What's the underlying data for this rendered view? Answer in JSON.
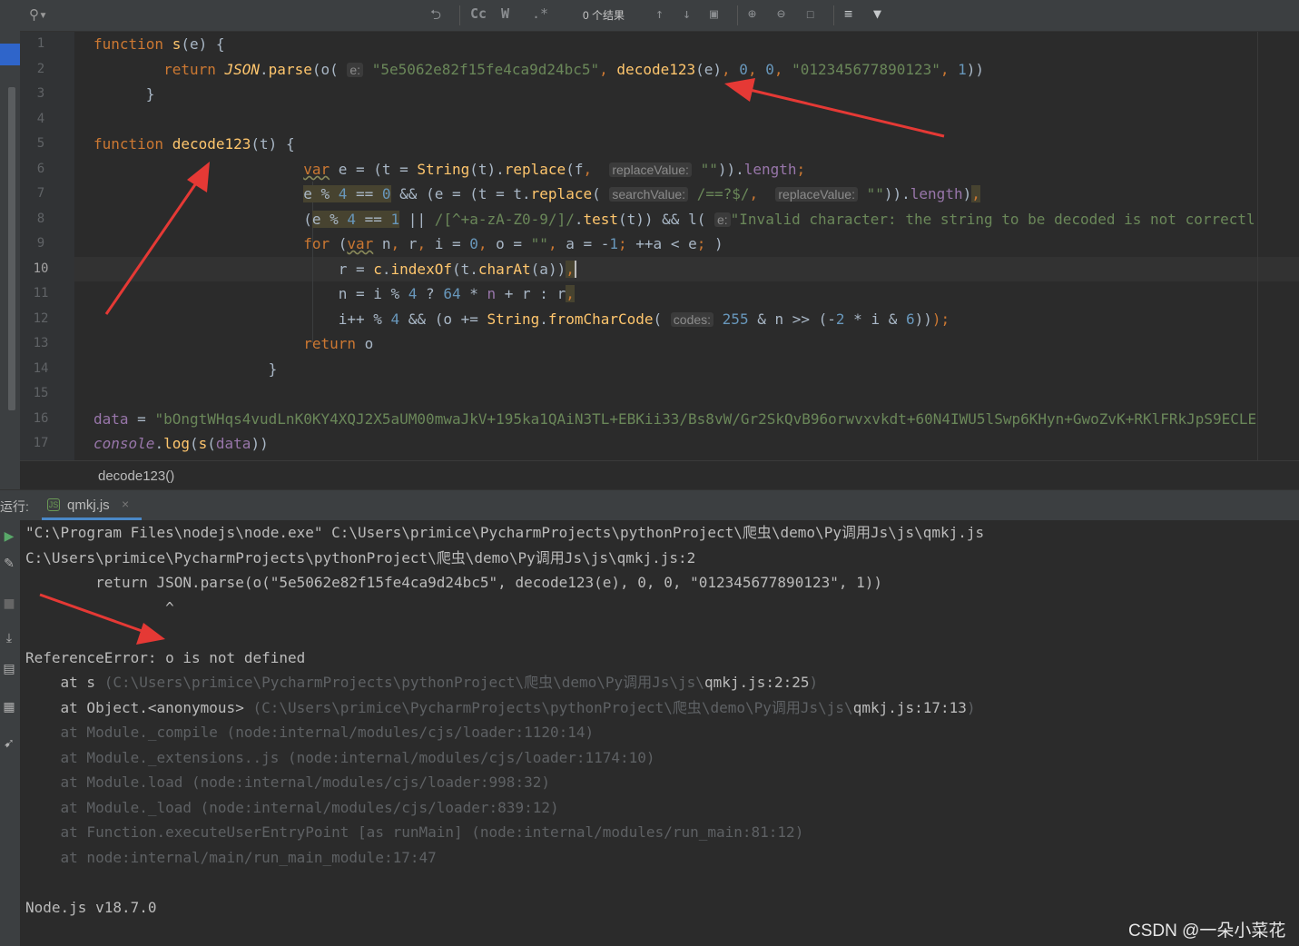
{
  "toolbar": {
    "search_icon": "search-icon",
    "match_case": "Cc",
    "whole_word": "W",
    "regex": ".*",
    "results": "0 个结果"
  },
  "editor": {
    "line_numbers": [
      "1",
      "2",
      "3",
      "4",
      "5",
      "6",
      "7",
      "8",
      "9",
      "10",
      "11",
      "12",
      "13",
      "14",
      "15",
      "16",
      "17"
    ],
    "current_line": "10",
    "hints": {
      "e": "e:",
      "replaceValue": "replaceValue:",
      "searchValue": "searchValue:",
      "codes": "codes:"
    },
    "strings": {
      "key": "\"5e5062e82f15fe4ca9d24bc5\"",
      "iv": "\"012345677890123\"",
      "regex1": "/==?$/",
      "empty": "\"\"",
      "regex2": "/[^+a-zA-Z0-9/]/",
      "invalid": "\"Invalid character: the string to be decoded is not correctl",
      "data_value": "\"bOngtWHqs4vudLnK0KY4XQJ2X5aUM00mwaJkV+195ka1QAiN3TL+EBKii33/Bs8vW/Gr2SkQvB96orwvxvkdt+60N4IWU5lSwp6KHyn+GwoZvK+RKlFRkJpS9ECLE"
    }
  },
  "breadcrumb": "decode123()",
  "run": {
    "label": "运行:",
    "tab_title": "qmkj.js",
    "close": "×"
  },
  "console": {
    "cmd": "\"C:\\Program Files\\nodejs\\node.exe\" C:\\Users\\primice\\PycharmProjects\\pythonProject\\爬虫\\demo\\Py调用Js\\js\\qmkj.js",
    "file_line": "C:\\Users\\primice\\PycharmProjects\\pythonProject\\爬虫\\demo\\Py调用Js\\js\\qmkj.js:2",
    "source_line": "        return JSON.parse(o(\"5e5062e82f15fe4ca9d24bc5\", decode123(e), 0, 0, \"012345677890123\", 1))",
    "caret": "                ^",
    "error": "ReferenceError: o is not defined",
    "at1_prefix": "    at s ",
    "at1_path": "(C:\\Users\\primice\\PycharmProjects\\pythonProject\\爬虫\\demo\\Py调用Js\\js\\",
    "at1_file": "qmkj.js:2:25",
    "at1_close": ")",
    "at2_prefix": "    at Object.<anonymous> ",
    "at2_path": "(C:\\Users\\primice\\PycharmProjects\\pythonProject\\爬虫\\demo\\Py调用Js\\js\\",
    "at2_file": "qmkj.js:17:13",
    "at2_close": ")",
    "internal": [
      "    at Module._compile (node:internal/modules/cjs/loader:1120:14)",
      "    at Module._extensions..js (node:internal/modules/cjs/loader:1174:10)",
      "    at Module.load (node:internal/modules/cjs/loader:998:32)",
      "    at Module._load (node:internal/modules/cjs/loader:839:12)",
      "    at Function.executeUserEntryPoint [as runMain] (node:internal/modules/run_main:81:12)",
      "    at node:internal/main/run_main_module:17:47"
    ],
    "version": "Node.js v18.7.0"
  },
  "watermark": "CSDN @一朵小菜花",
  "colors": {
    "arrow": "#e53935",
    "keyword": "#cc7832",
    "function": "#ffc66d",
    "string": "#6a8759",
    "number": "#6897bb"
  }
}
